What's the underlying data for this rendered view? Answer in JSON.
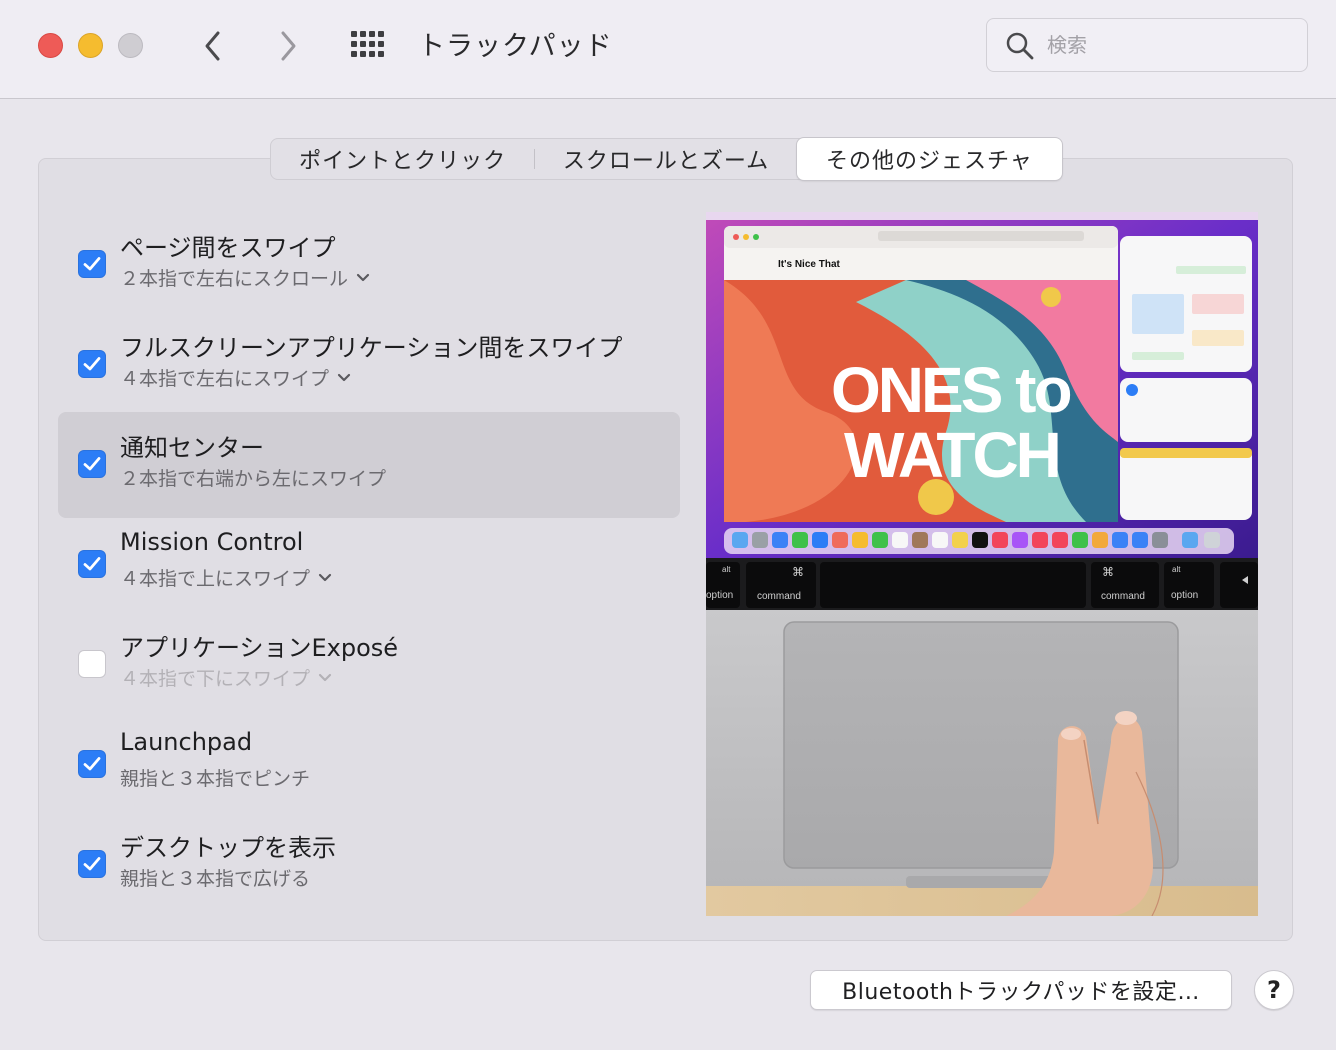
{
  "window": {
    "title": "トラックパッド",
    "search_placeholder": "検索"
  },
  "tabs": [
    {
      "label": "ポイントとクリック",
      "selected": false
    },
    {
      "label": "スクロールとズーム",
      "selected": false
    },
    {
      "label": "その他のジェスチャ",
      "selected": true
    }
  ],
  "gestures": [
    {
      "title": "ページ間をスワイプ",
      "subtitle": "２本指で左右にスクロール",
      "checked": true,
      "has_menu": true
    },
    {
      "title": "フルスクリーンアプリケーション間をスワイプ",
      "subtitle": "４本指で左右にスワイプ",
      "checked": true,
      "has_menu": true
    },
    {
      "title": "通知センター",
      "subtitle": "２本指で右端から左にスワイプ",
      "checked": true,
      "has_menu": false,
      "selected": true
    },
    {
      "title": "Mission Control",
      "subtitle": "４本指で上にスワイプ",
      "checked": true,
      "has_menu": true
    },
    {
      "title": "アプリケーションExposé",
      "subtitle": "４本指で下にスワイプ",
      "checked": false,
      "has_menu": true
    },
    {
      "title": "Launchpad",
      "subtitle": "親指と３本指でピンチ",
      "checked": true,
      "has_menu": false
    },
    {
      "title": "デスクトップを表示",
      "subtitle": "親指と３本指で広げる",
      "checked": true,
      "has_menu": false
    }
  ],
  "preview": {
    "headline_line1": "ONES to",
    "headline_line2": "WATCH",
    "site_name": "It's Nice That",
    "key_option": "option",
    "key_command": "command",
    "key_alt": "alt",
    "key_cmd_symbol": "⌘"
  },
  "footer": {
    "bluetooth_button": "Bluetoothトラックパッドを設定…",
    "help_button": "?"
  },
  "colors": {
    "accent": "#2c7df6",
    "close": "#ee5b57",
    "minimize": "#f5bc2f",
    "zoom_inactive": "#cfcdd2"
  }
}
